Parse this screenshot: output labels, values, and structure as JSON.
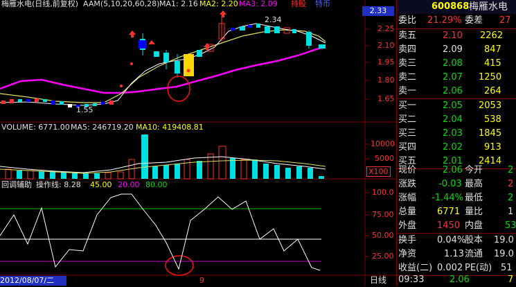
{
  "header": {
    "stock_name_period": "梅雁水电(日线,前复权)",
    "aam_label": "AAM(5,10,20,60,28)",
    "ma1": "MA1: 2.16",
    "ma2": "MA2: 2.20",
    "ma3": "MA3: 2.09",
    "tab_hold": "持股",
    "tab_other": "特币"
  },
  "price_axis": {
    "badge": "2.33",
    "ticks": [
      "2.25",
      "2.10",
      "1.95",
      "1.80",
      "1.65"
    ]
  },
  "annotations": {
    "high": "2.34",
    "low": "1.55"
  },
  "volume": {
    "label": "VOLUME: 6771.00",
    "ma5": "MA5: 246719.20",
    "ma10": "MA10: 419408.81",
    "ticks": [
      "10000",
      "5000"
    ],
    "unit": "X100"
  },
  "indicator": {
    "name": "回调辅助",
    "label": "操作线: 8.28",
    "v1": "45.00",
    "v2": "20.00",
    "v3": "80.00",
    "ticks": [
      "100.0",
      "75.00",
      "50.00",
      "25.00"
    ]
  },
  "footer": {
    "date": "2012/08/07/二",
    "marker": "9",
    "period_button": "日线"
  },
  "quote": {
    "code": "600868",
    "name": "梅雁水电",
    "weibi_label": "委比",
    "weibi_value": "21.29%",
    "weicha_label": "委差",
    "weicha_value": "27",
    "asks": [
      {
        "label": "卖五",
        "price": "2.10",
        "vol": "2262"
      },
      {
        "label": "卖四",
        "price": "2.09",
        "vol": "847"
      },
      {
        "label": "卖三",
        "price": "2.08",
        "vol": "415"
      },
      {
        "label": "卖二",
        "price": "2.07",
        "vol": "1250"
      },
      {
        "label": "卖一",
        "price": "2.06",
        "vol": "264"
      }
    ],
    "bids": [
      {
        "label": "买一",
        "price": "2.05",
        "vol": "2053"
      },
      {
        "label": "买二",
        "price": "2.04",
        "vol": "538"
      },
      {
        "label": "买三",
        "price": "2.03",
        "vol": "1845"
      },
      {
        "label": "买四",
        "price": "2.02",
        "vol": "913"
      },
      {
        "label": "买五",
        "price": "2.01",
        "vol": "2414"
      }
    ],
    "stats": [
      {
        "l1": "现价",
        "v1": "2.06",
        "l2": "今开",
        "v2": "2"
      },
      {
        "l1": "涨跌",
        "v1": "-0.03",
        "l2": "最高",
        "v2": "2"
      },
      {
        "l1": "涨幅",
        "v1": "-1.44%",
        "l2": "最低",
        "v2": "2"
      },
      {
        "l1": "总量",
        "v1": "6771",
        "l2": "量比",
        "v2": "1"
      },
      {
        "l1": "外盘",
        "v1": "1450",
        "l2": "内盘",
        "v2": "53"
      }
    ],
    "stats2": [
      {
        "l1": "换手",
        "v1": "0.04%",
        "l2": "股本",
        "v2": "19.0"
      },
      {
        "l1": "净资",
        "v1": "1.13",
        "l2": "流通",
        "v2": "19.0"
      },
      {
        "l1": "收益(二)",
        "v1": "0.002",
        "l2": "PE(动)",
        "v2": "51"
      }
    ],
    "tick": {
      "time": "09:33",
      "price": "2.06",
      "vol": "7"
    }
  },
  "colors": {
    "up": "#ff3030",
    "down": "#00e0e0",
    "ma_white": "#ffffff",
    "ma_yellow": "#ffff60",
    "ma_magenta": "#ff00ff"
  }
}
